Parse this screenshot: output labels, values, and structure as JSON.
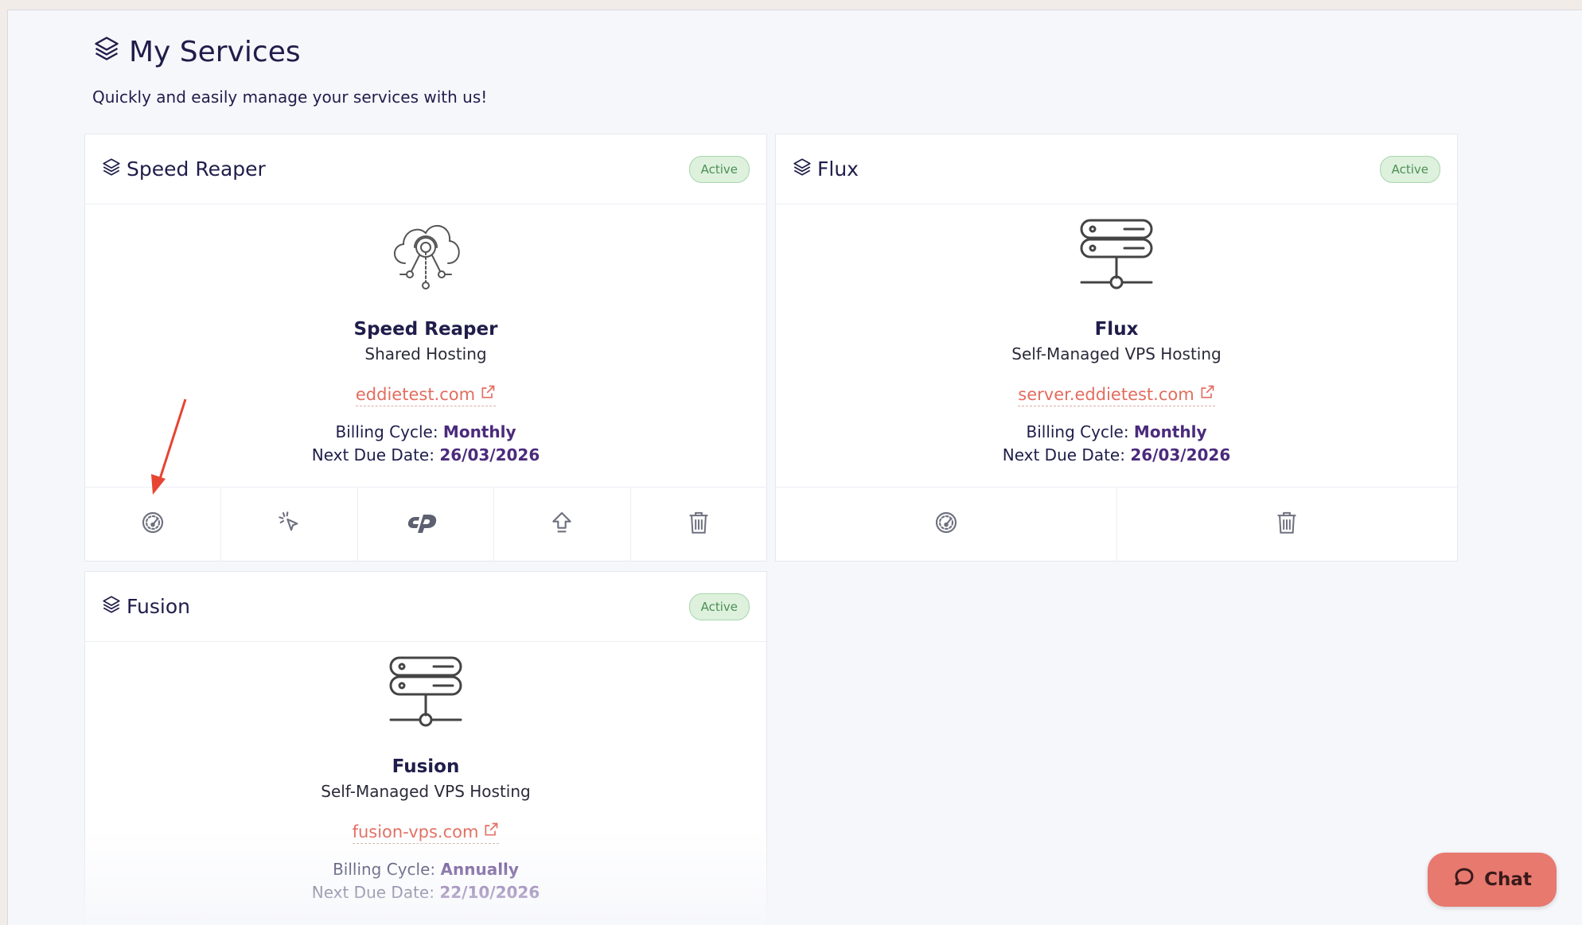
{
  "page": {
    "title": "My Services",
    "subtitle": "Quickly and easily manage your services with us!"
  },
  "services": [
    {
      "header": "Speed Reaper",
      "status": "Active",
      "icon": "cloud-network-icon",
      "name": "Speed Reaper",
      "type": "Shared Hosting",
      "domain": "eddietest.com",
      "billing_label": "Billing Cycle:",
      "billing_cycle": "Monthly",
      "due_label": "Next Due Date:",
      "due_date": "26/03/2026",
      "actions": [
        "speedometer-icon",
        "cursor-click-icon",
        "cpanel-icon",
        "upgrade-arrow-icon",
        "trash-icon"
      ]
    },
    {
      "header": "Flux",
      "status": "Active",
      "icon": "server-icon",
      "name": "Flux",
      "type": "Self-Managed VPS Hosting",
      "domain": "server.eddietest.com",
      "billing_label": "Billing Cycle:",
      "billing_cycle": "Monthly",
      "due_label": "Next Due Date:",
      "due_date": "26/03/2026",
      "actions": [
        "speedometer-icon",
        "trash-icon"
      ]
    },
    {
      "header": "Fusion",
      "status": "Active",
      "icon": "server-icon",
      "name": "Fusion",
      "type": "Self-Managed VPS Hosting",
      "domain": "fusion-vps.com",
      "billing_label": "Billing Cycle:",
      "billing_cycle": "Annually",
      "due_label": "Next Due Date:",
      "due_date": "22/10/2026"
    }
  ],
  "chat": {
    "label": "Chat"
  },
  "colors": {
    "accent": "#e26d5f",
    "heading": "#1f1d4a",
    "badge_bg": "#ddf1dd",
    "badge_text": "#4d8f55",
    "chat_bg": "#e7796e",
    "annotation_arrow": "#e64533"
  }
}
